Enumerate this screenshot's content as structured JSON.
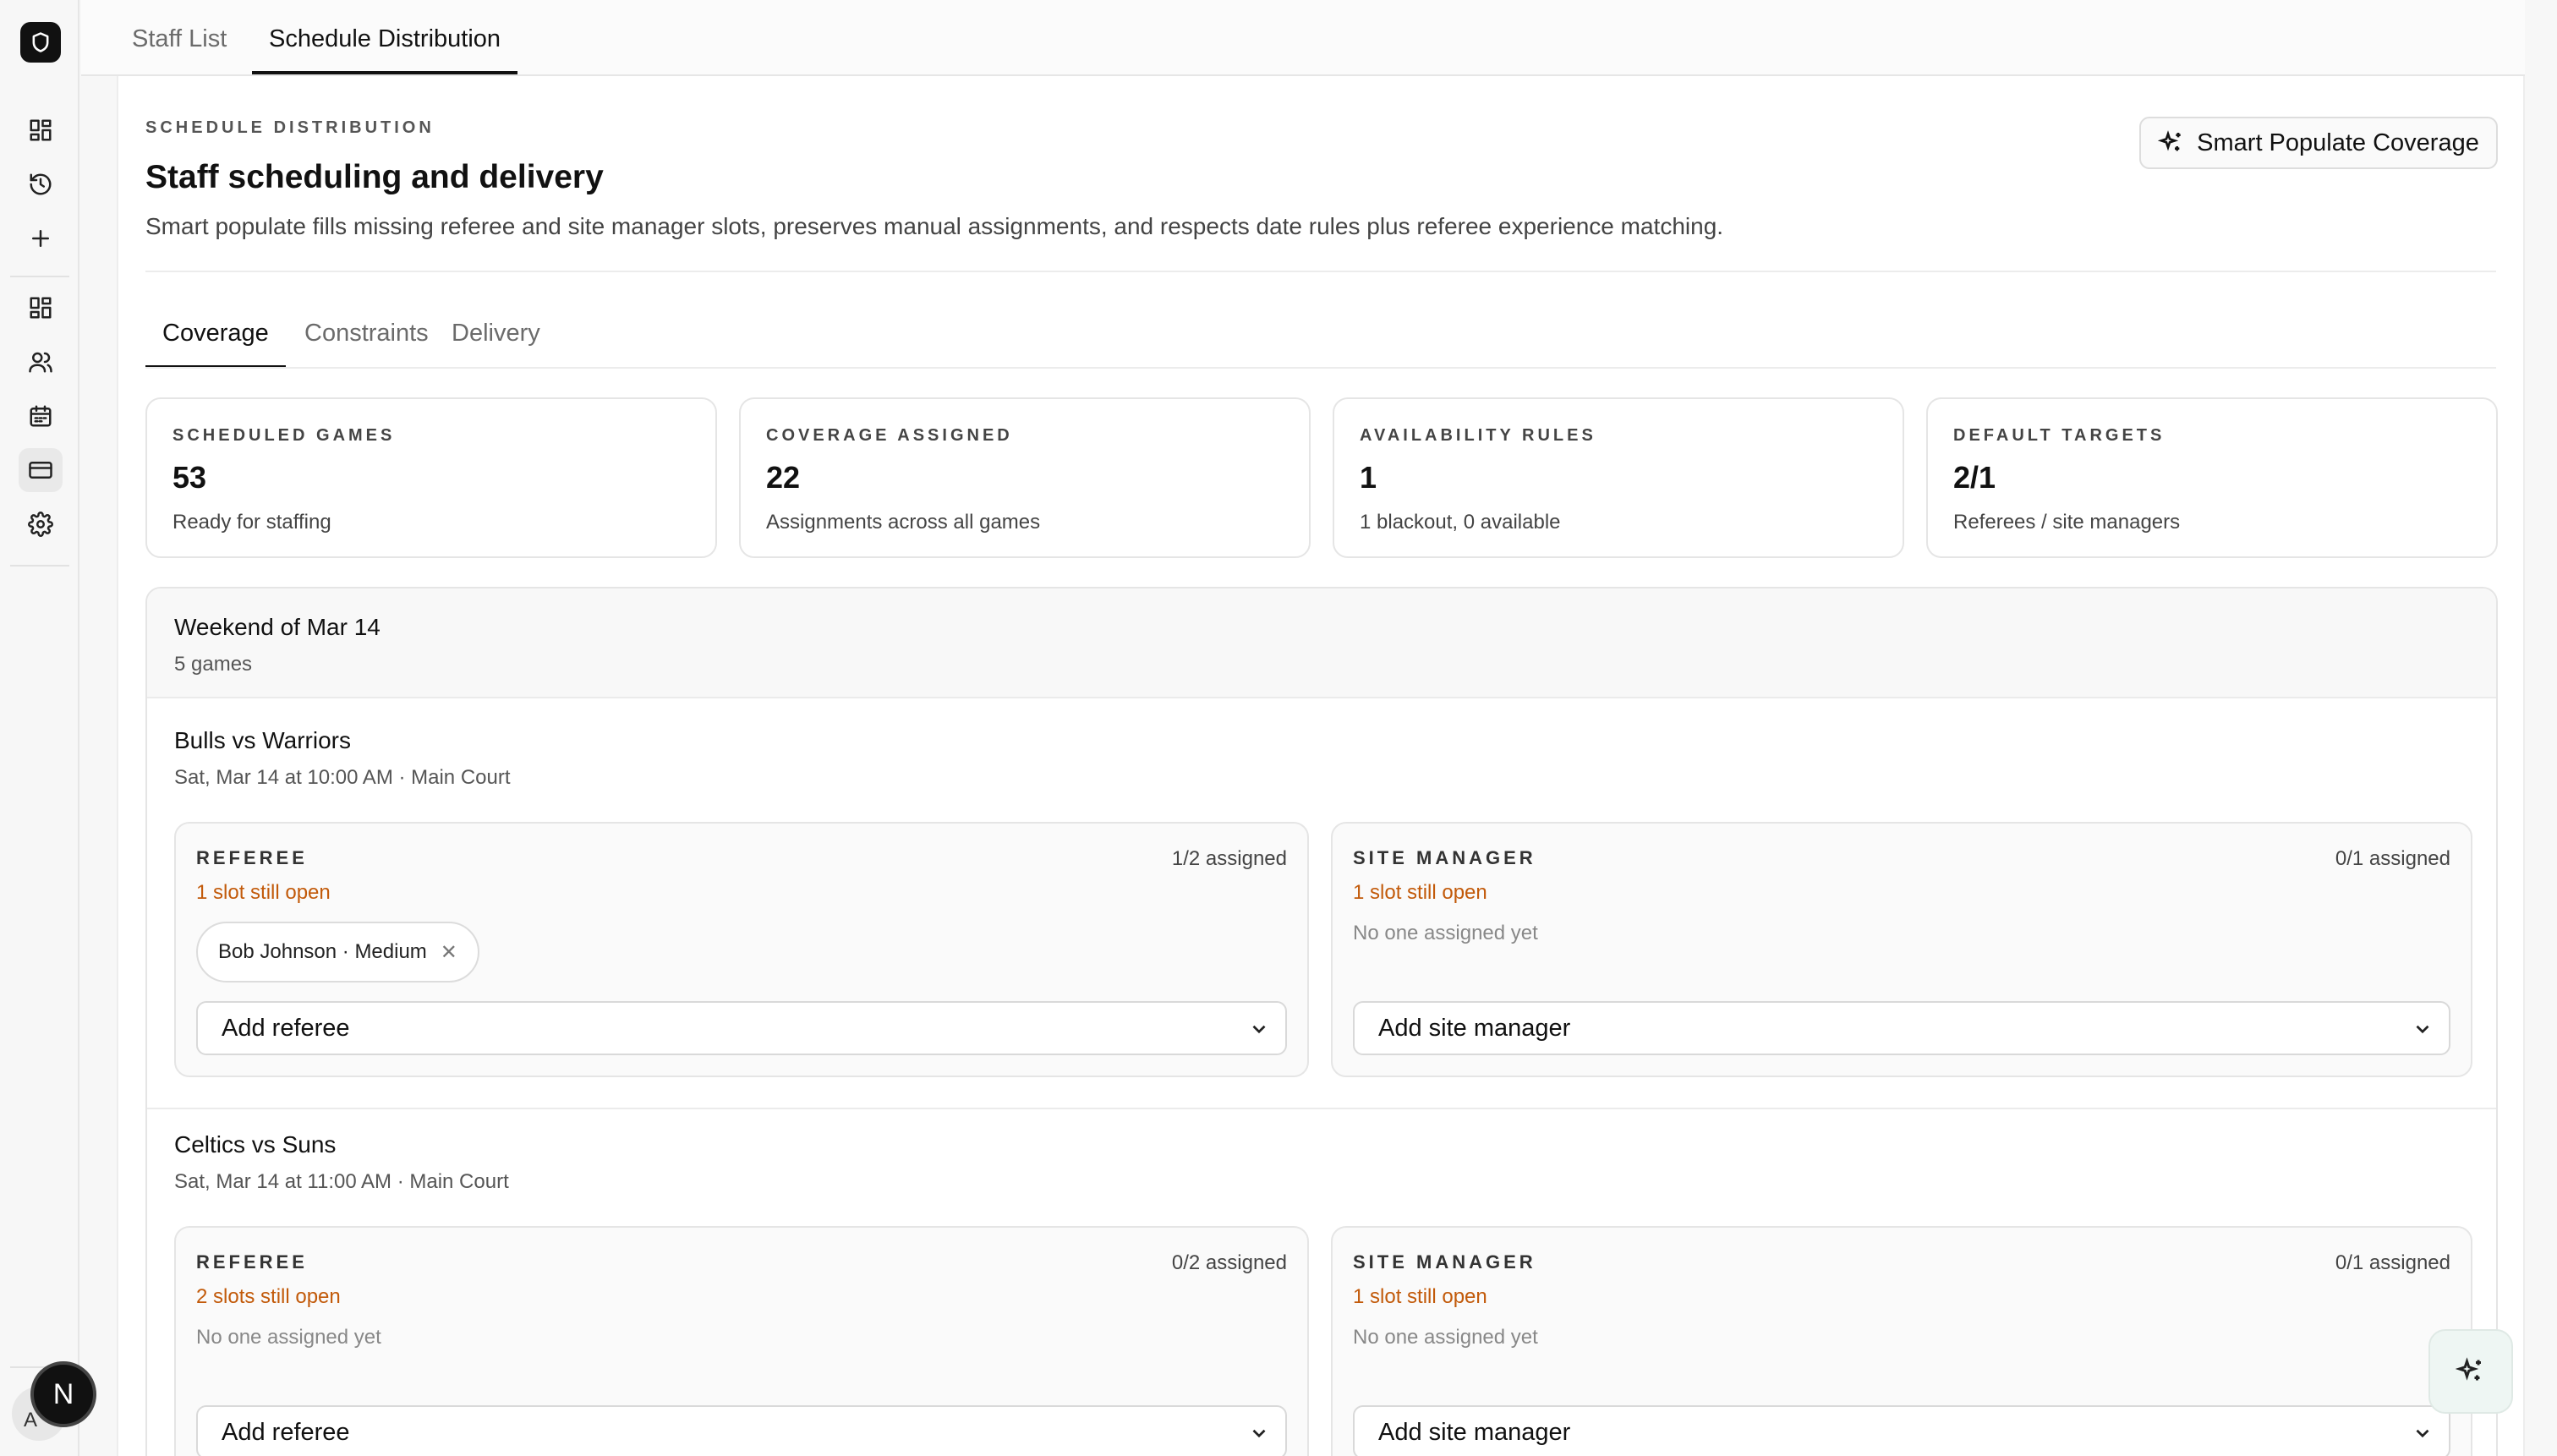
{
  "top_tabs": [
    {
      "label": "Staff List"
    },
    {
      "label": "Schedule Distribution"
    }
  ],
  "header": {
    "eyebrow": "SCHEDULE DISTRIBUTION",
    "title": "Staff scheduling and delivery",
    "description": "Smart populate fills missing referee and site manager slots, preserves manual assignments, and respects date rules plus referee experience matching.",
    "smart_button_label": "Smart Populate Coverage"
  },
  "sub_tabs": [
    {
      "label": "Coverage"
    },
    {
      "label": "Constraints"
    },
    {
      "label": "Delivery"
    }
  ],
  "stats": [
    {
      "label": "SCHEDULED GAMES",
      "value": "53",
      "sub": "Ready for staffing"
    },
    {
      "label": "COVERAGE ASSIGNED",
      "value": "22",
      "sub": "Assignments across all games"
    },
    {
      "label": "AVAILABILITY RULES",
      "value": "1",
      "sub": "1 blackout, 0 available"
    },
    {
      "label": "DEFAULT TARGETS",
      "value": "2/1",
      "sub": "Referees / site managers"
    }
  ],
  "weekend": {
    "title": "Weekend of Mar 14",
    "count": "5 games",
    "games": [
      {
        "title": "Bulls vs Warriors",
        "sub": "Sat, Mar 14 at 10:00 AM · Main Court",
        "referee": {
          "label": "REFEREE",
          "count": "1/2 assigned",
          "open": "1 slot still open",
          "chip": "Bob Johnson · Medium",
          "select": "Add referee"
        },
        "site_manager": {
          "label": "SITE MANAGER",
          "count": "0/1 assigned",
          "open": "1 slot still open",
          "none": "No one assigned yet",
          "select": "Add site manager"
        }
      },
      {
        "title": "Celtics vs Suns",
        "sub": "Sat, Mar 14 at 11:00 AM · Main Court",
        "referee": {
          "label": "REFEREE",
          "count": "0/2 assigned",
          "open": "2 slots still open",
          "none": "No one assigned yet",
          "select": "Add referee"
        },
        "site_manager": {
          "label": "SITE MANAGER",
          "count": "0/1 assigned",
          "open": "1 slot still open",
          "none": "No one assigned yet",
          "select": "Add site manager"
        }
      }
    ]
  },
  "user": {
    "avatar_text": "A",
    "badge_text": "N"
  },
  "colors": {
    "accent": "#111111",
    "warning": "#c25a0a"
  }
}
